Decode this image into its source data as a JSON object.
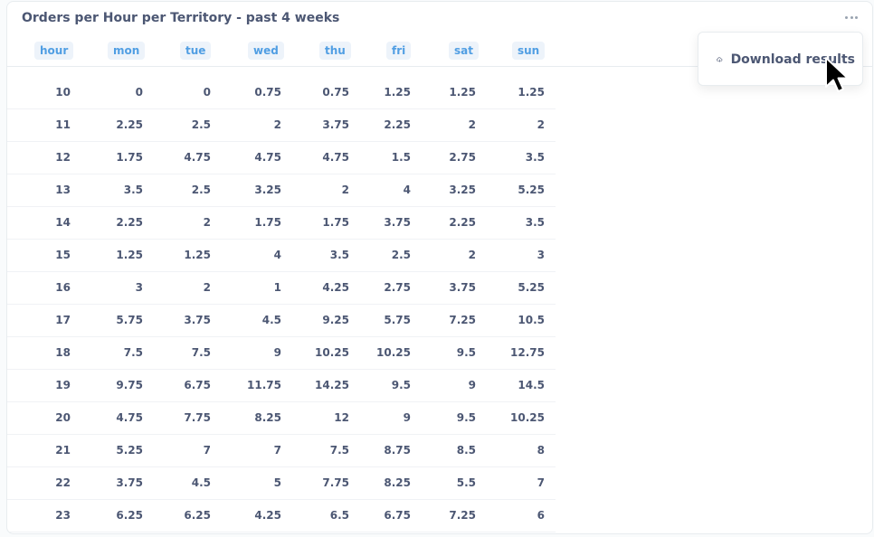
{
  "card": {
    "title": "Orders per Hour per Territory - past 4 weeks"
  },
  "table": {
    "columns": [
      "hour",
      "mon",
      "tue",
      "wed",
      "thu",
      "fri",
      "sat",
      "sun"
    ],
    "rows": [
      [
        "10",
        "0",
        "0",
        "0.75",
        "0.75",
        "1.25",
        "1.25",
        "1.25"
      ],
      [
        "11",
        "2.25",
        "2.5",
        "2",
        "3.75",
        "2.25",
        "2",
        "2"
      ],
      [
        "12",
        "1.75",
        "4.75",
        "4.75",
        "4.75",
        "1.5",
        "2.75",
        "3.5"
      ],
      [
        "13",
        "3.5",
        "2.5",
        "3.25",
        "2",
        "4",
        "3.25",
        "5.25"
      ],
      [
        "14",
        "2.25",
        "2",
        "1.75",
        "1.75",
        "3.75",
        "2.25",
        "3.5"
      ],
      [
        "15",
        "1.25",
        "1.25",
        "4",
        "3.5",
        "2.5",
        "2",
        "3"
      ],
      [
        "16",
        "3",
        "2",
        "1",
        "4.25",
        "2.75",
        "3.75",
        "5.25"
      ],
      [
        "17",
        "5.75",
        "3.75",
        "4.5",
        "9.25",
        "5.75",
        "7.25",
        "10.5"
      ],
      [
        "18",
        "7.5",
        "7.5",
        "9",
        "10.25",
        "10.25",
        "9.5",
        "12.75"
      ],
      [
        "19",
        "9.75",
        "6.75",
        "11.75",
        "14.25",
        "9.5",
        "9",
        "14.5"
      ],
      [
        "20",
        "4.75",
        "7.75",
        "8.25",
        "12",
        "9",
        "9.5",
        "10.25"
      ],
      [
        "21",
        "5.25",
        "7",
        "7",
        "7.5",
        "8.75",
        "8.5",
        "8"
      ],
      [
        "22",
        "3.75",
        "4.5",
        "5",
        "7.75",
        "8.25",
        "5.5",
        "7"
      ],
      [
        "23",
        "6.25",
        "6.25",
        "4.25",
        "6.5",
        "6.75",
        "7.25",
        "6"
      ]
    ]
  },
  "menu": {
    "download_label": "Download results",
    "download_icon": "cloud-download-icon"
  },
  "icons": {
    "more": "more-options-icon",
    "cursor": "mouse-pointer-icon"
  },
  "colors": {
    "header_text": "#509ee3",
    "header_bg": "#edf3fa",
    "body_text": "#4c5773"
  }
}
